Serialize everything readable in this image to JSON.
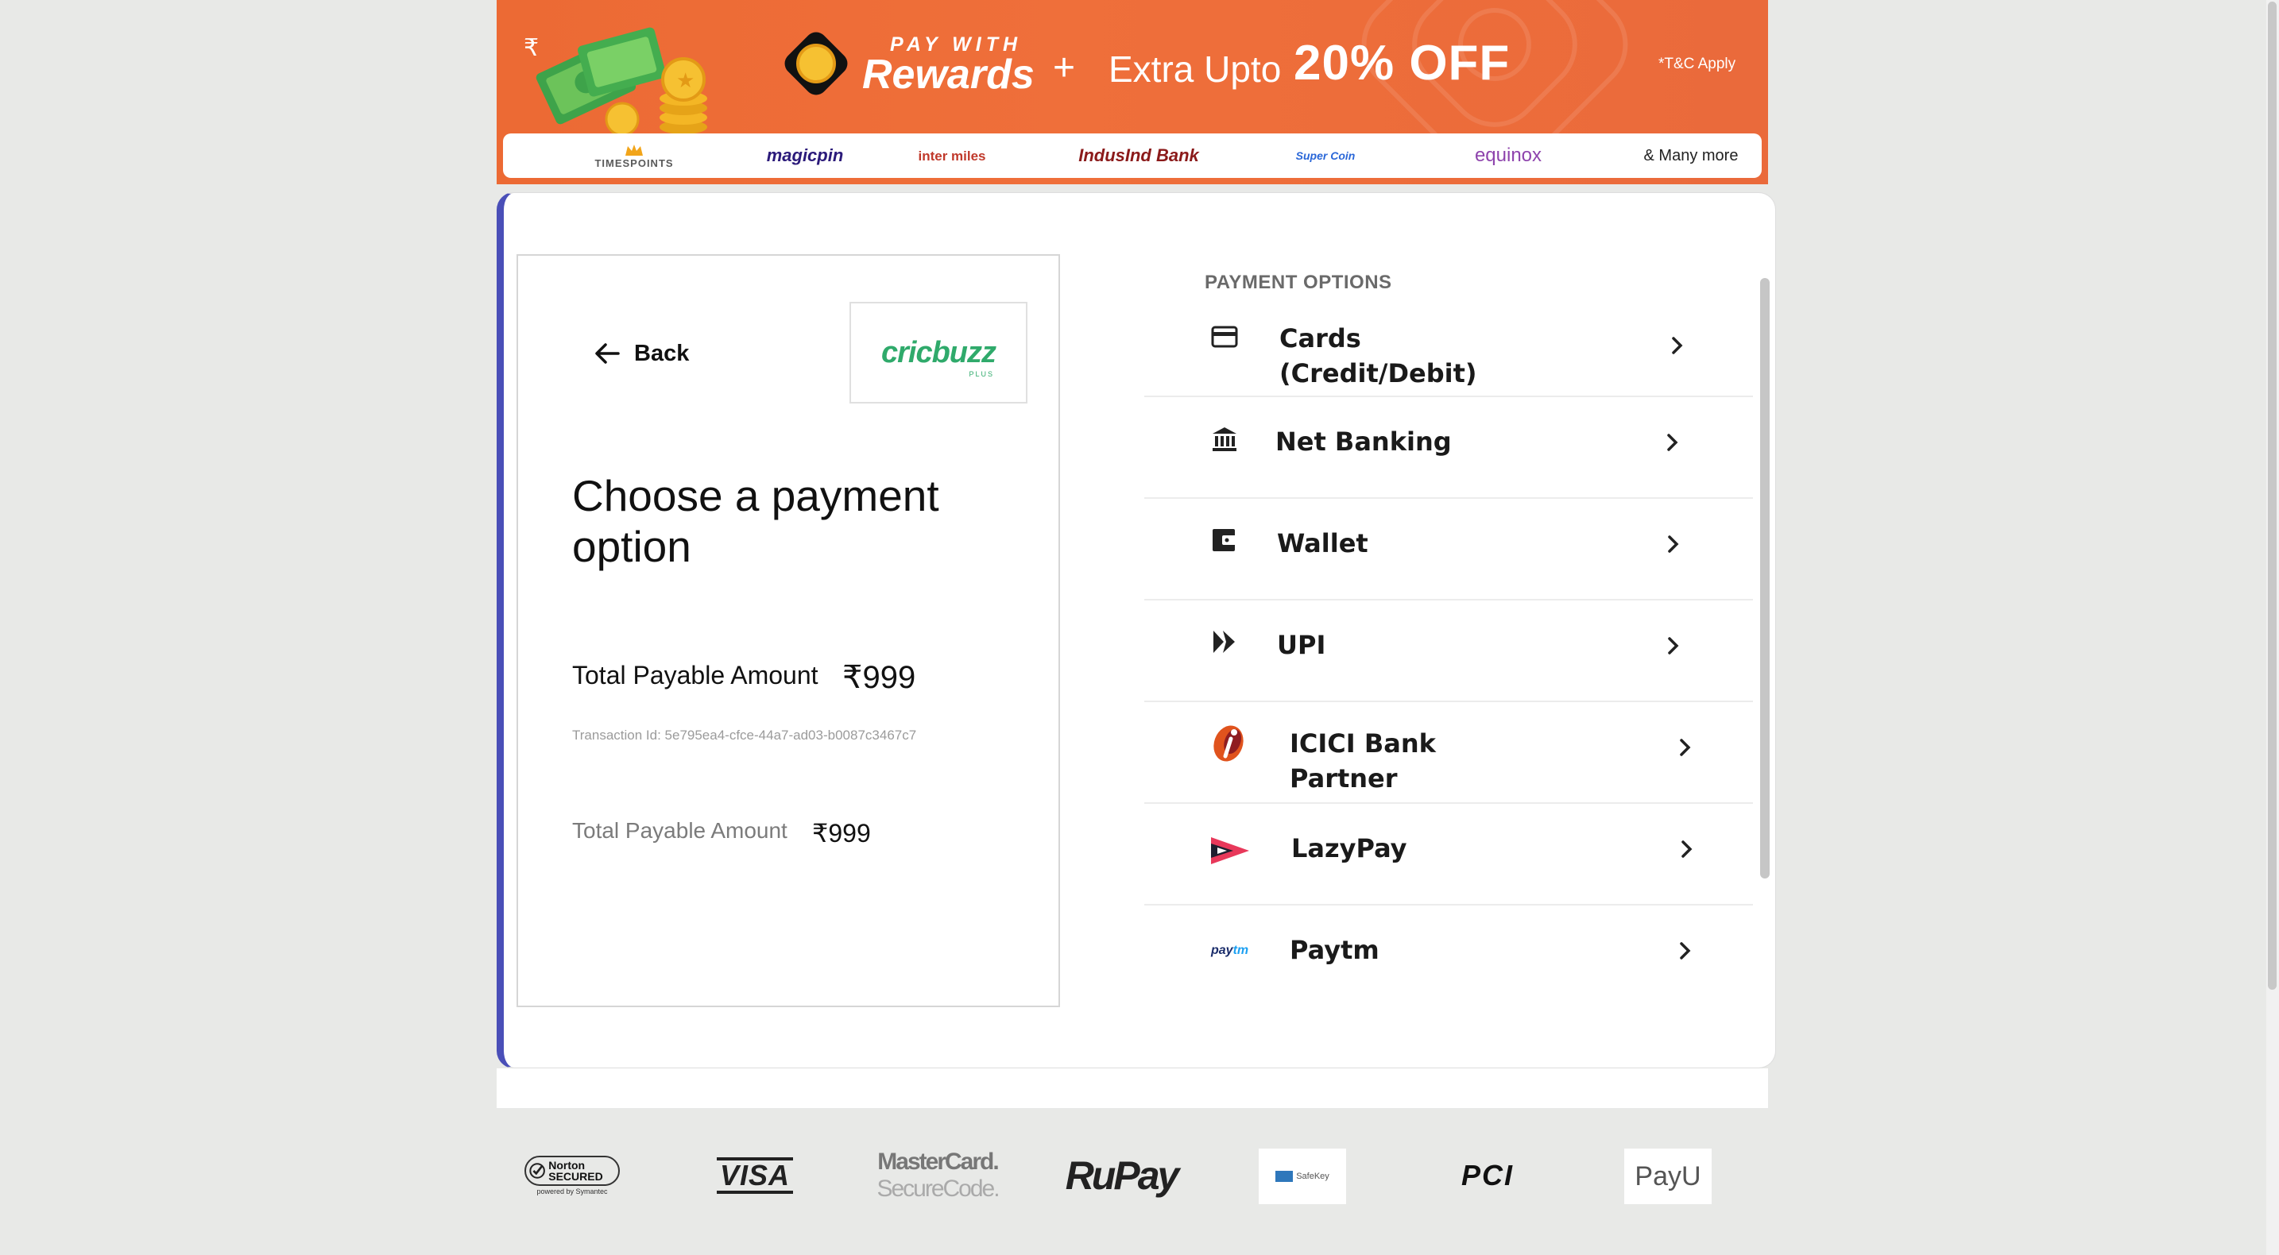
{
  "banner": {
    "pay_with": "PAY WITH",
    "rewards": "Rewards",
    "plus": "+",
    "extra_upto": "Extra Upto",
    "discount": "20% OFF",
    "tnc": "*T&C Apply",
    "partners": [
      {
        "name": "TIMESPOINTS",
        "color": "#5a5a5a"
      },
      {
        "name": "magicpin",
        "color": "#2b1a7a"
      },
      {
        "name": "inter miles",
        "color": "#c0392b"
      },
      {
        "name": "IndusInd Bank",
        "color": "#8b1a1a"
      },
      {
        "name": "Super Coin",
        "color": "#2a67d8"
      },
      {
        "name": "equinox",
        "color": "#8e44ad"
      },
      {
        "name": "& Many more",
        "color": "#222222"
      }
    ]
  },
  "left_panel": {
    "back_label": "Back",
    "merchant_logo": "cricbuzz",
    "merchant_logo_sub": "PLUS",
    "title": "Choose a payment option",
    "total_label": "Total Payable Amount",
    "total_value": "₹999",
    "transaction_id": "Transaction Id: 5e795ea4-cfce-44a7-ad03-b0087c3467c7",
    "total_label_2": "Total Payable Amount",
    "total_value_2": "₹999"
  },
  "payment_options": {
    "heading": "PAYMENT OPTIONS",
    "items": [
      {
        "label_1": "Cards",
        "label_2": "(Credit/Debit)",
        "icon": "card-icon"
      },
      {
        "label_1": "Net Banking",
        "label_2": "",
        "icon": "bank-icon"
      },
      {
        "label_1": "Wallet",
        "label_2": "",
        "icon": "wallet-icon"
      },
      {
        "label_1": "UPI",
        "label_2": "",
        "icon": "upi-icon"
      },
      {
        "label_1": "ICICI Bank",
        "label_2": "Partner",
        "icon": "icici-icon"
      },
      {
        "label_1": "LazyPay",
        "label_2": "",
        "icon": "lazypay-icon"
      },
      {
        "label_1": "Paytm",
        "label_2": "",
        "icon": "paytm-icon"
      }
    ]
  },
  "footer": {
    "badges": [
      "Norton SECURED",
      "powered by Symantec",
      "VISA",
      "MasterCard.",
      "SecureCode.",
      "RuPay",
      "SafeKey",
      "PCI",
      "PayU"
    ]
  },
  "colors": {
    "banner": "#ec6a34",
    "accent_border": "#4a4fb8",
    "cricbuzz_green": "#2faa6b"
  }
}
